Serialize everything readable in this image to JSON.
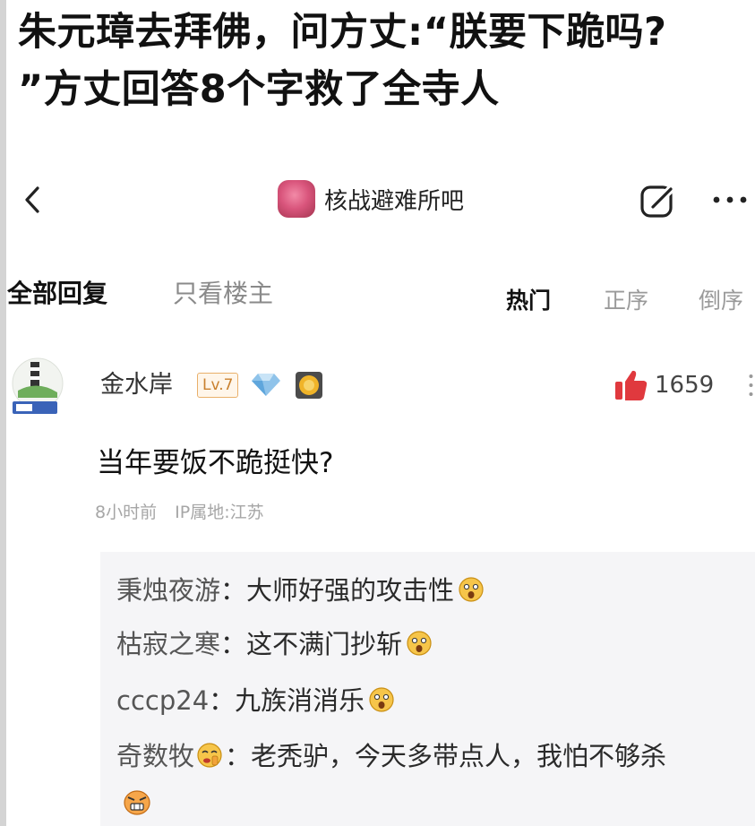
{
  "headline": {
    "line1": "朱元璋去拜佛，问方丈:“朕要下跪吗?",
    "line2": "”方丈回答8个字救了全寺人"
  },
  "header": {
    "forum_name": "核战避难所吧",
    "icons": {
      "back": "chevron-left-icon",
      "edit": "edit-icon",
      "more": "more-icon"
    }
  },
  "tabs": {
    "all": "全部回复",
    "op_only": "只看楼主"
  },
  "sort": {
    "hot": "热门",
    "asc": "正序",
    "desc": "倒序"
  },
  "comment": {
    "username": "金水岸",
    "level": "Lv.7",
    "likes": "1659",
    "text": "当年要饭不跪挺快?",
    "time": "8小时前",
    "ip": "IP属地:江苏",
    "colors": {
      "like": "#e0393e",
      "level": "#c9802e"
    }
  },
  "replies": [
    {
      "name": "秉烛夜游",
      "sep": "：",
      "text": "大师好强的攻击性"
    },
    {
      "name": "枯寂之寒",
      "sep": "：",
      "text": "这不满门抄斩"
    },
    {
      "name": "cccp24",
      "sep": "：",
      "text": "九族消消乐"
    },
    {
      "name": "奇数牧",
      "sep": "：",
      "text": "老秃驴，今天多带点人，我怕不够杀"
    }
  ]
}
